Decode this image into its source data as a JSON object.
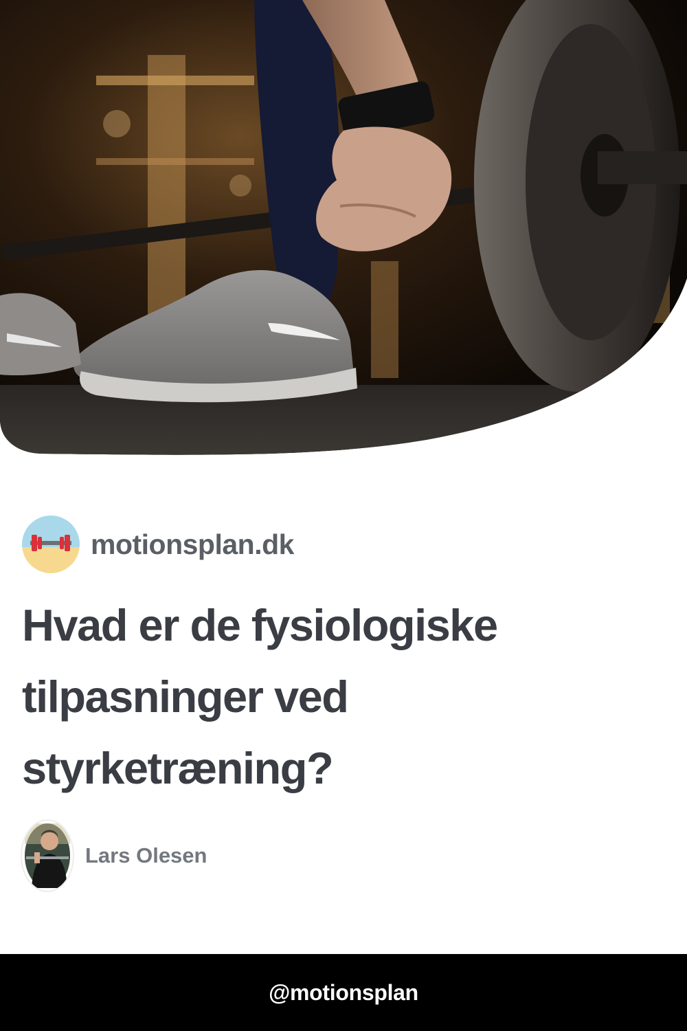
{
  "hero": {
    "image_subject": "barbell-deadlift-photo"
  },
  "brand": {
    "logo_icon": "dumbbell-beach-logo-icon",
    "name": "motionsplan.dk"
  },
  "article": {
    "title": "Hvad er de fysiologiske tilpasninger ved styrketræning?"
  },
  "author": {
    "avatar_icon": "author-portrait",
    "name": "Lars Olesen"
  },
  "footer": {
    "handle": "@motionsplan"
  },
  "colors": {
    "title": "#3a3d43",
    "brand_text": "#5a5f66",
    "author_text": "#73787f",
    "footer_bg": "#000000",
    "footer_text": "#ffffff",
    "logo_sky": "#a9d8ea",
    "logo_sand": "#f6d98f",
    "logo_weight": "#d9303a"
  }
}
